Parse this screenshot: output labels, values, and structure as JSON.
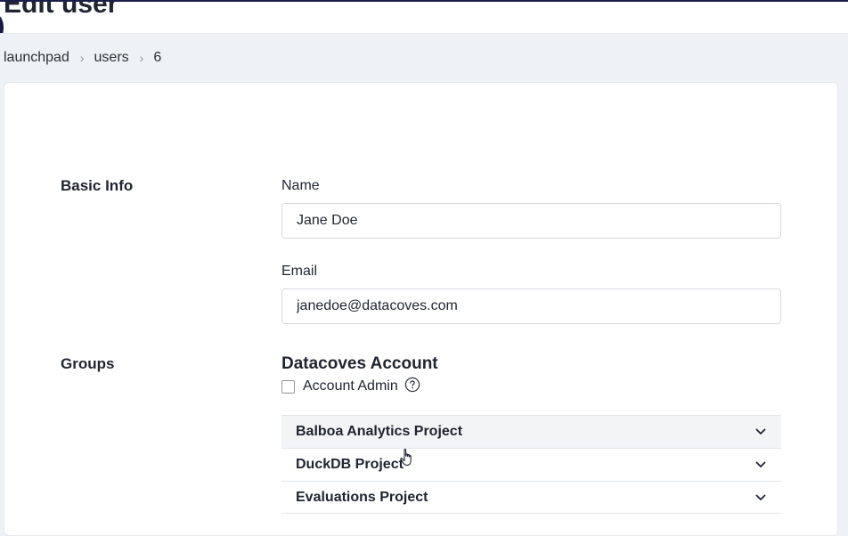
{
  "page": {
    "title": "Edit user"
  },
  "breadcrumb": {
    "items": [
      "launchpad",
      "users",
      "6"
    ],
    "separator": "›"
  },
  "basic_info": {
    "section_label": "Basic Info",
    "name_label": "Name",
    "name_value": "Jane Doe",
    "email_label": "Email",
    "email_value": "janedoe@datacoves.com"
  },
  "groups": {
    "section_label": "Groups",
    "account_title": "Datacoves Account",
    "account_admin_label": "Account Admin",
    "account_admin_checked": false,
    "help_icon": "question-circle-icon",
    "projects": [
      {
        "name": "Balboa Analytics Project",
        "icon": "chevron-down-icon"
      },
      {
        "name": "DuckDB Project",
        "icon": "chevron-down-icon"
      },
      {
        "name": "Evaluations Project",
        "icon": "chevron-down-icon"
      }
    ]
  },
  "colors": {
    "background": "#eef1f6",
    "card": "#ffffff",
    "header_accent": "#1a1f4a",
    "active_row": "#f3f4f6",
    "text": "#1f2430"
  }
}
